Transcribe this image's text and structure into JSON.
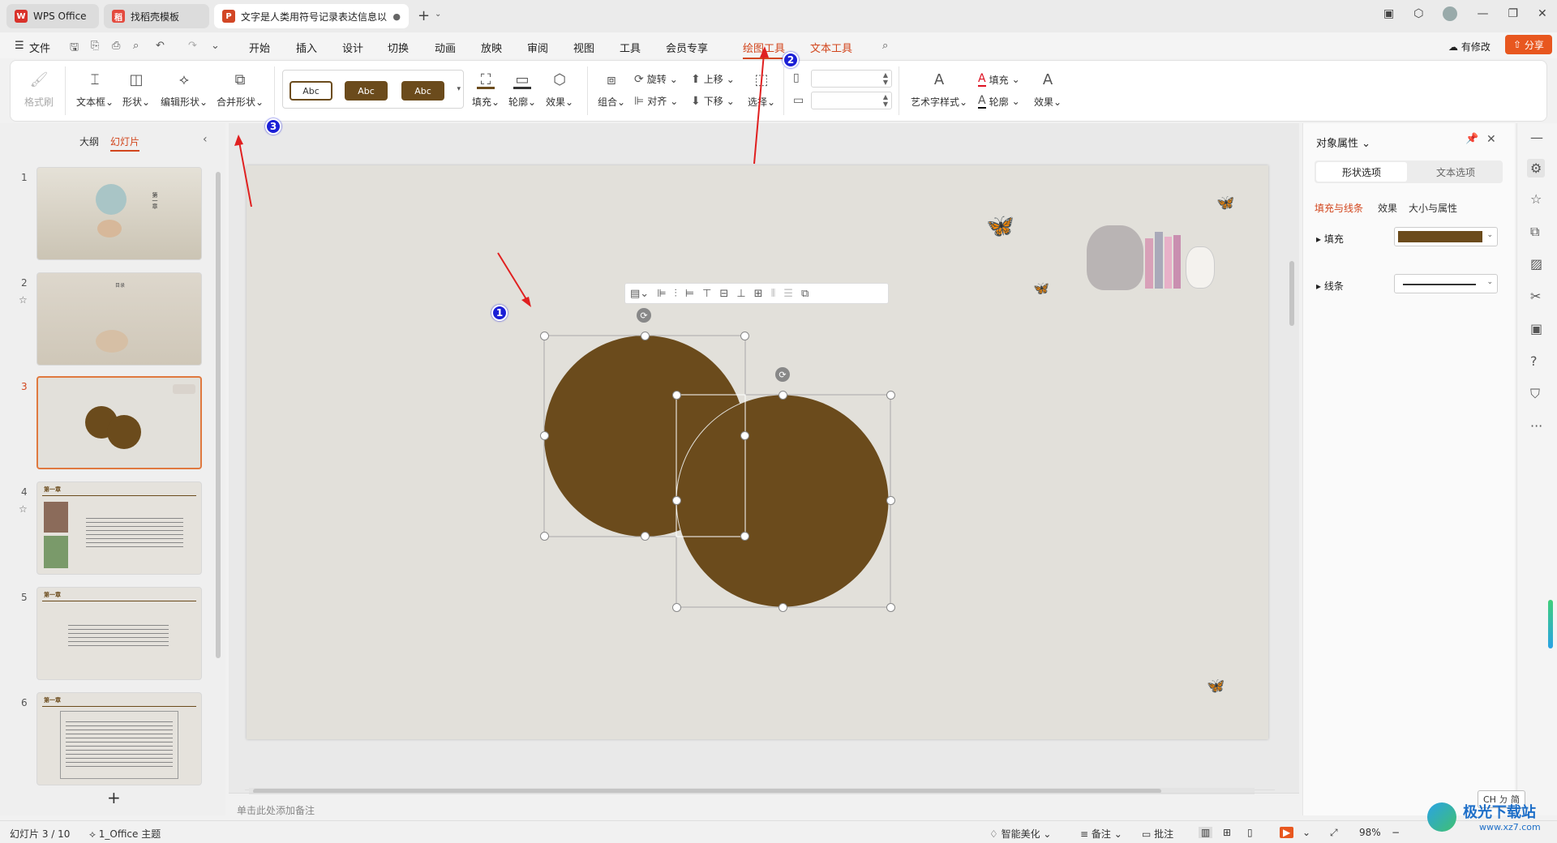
{
  "tabs": [
    {
      "label": "WPS Office",
      "logo": "W"
    },
    {
      "label": "找稻壳模板",
      "logo": "稻"
    },
    {
      "label": "文字是人类用符号记录表达信息以",
      "logo": "P"
    }
  ],
  "menu": {
    "file": "文件",
    "items": [
      "开始",
      "插入",
      "设计",
      "切换",
      "动画",
      "放映",
      "审阅",
      "视图",
      "工具",
      "会员专享"
    ],
    "drawing_tools": "绘图工具",
    "text_tools": "文本工具",
    "modify": "有修改",
    "share": "分享"
  },
  "ribbon": {
    "format_painter": "格式刷",
    "textbox": "文本框",
    "shape": "形状",
    "edit_shape": "编辑形状",
    "merge_shape": "合并形状",
    "style_samples": [
      "Abc",
      "Abc",
      "Abc"
    ],
    "fill": "填充",
    "outline": "轮廓",
    "effect": "效果",
    "rotate": "旋转",
    "align": "对齐",
    "bring_forward": "上移",
    "send_backward": "下移",
    "group": "组合",
    "select": "选择",
    "art_text": "艺术字样式",
    "text_fill": "填充",
    "text_outline": "轮廓",
    "text_effect": "效果"
  },
  "left_panel": {
    "tab_outline": "大纲",
    "tab_slides": "幻灯片",
    "slides": [
      {
        "num": "1",
        "title": "第一章"
      },
      {
        "num": "2",
        "title": "目录"
      },
      {
        "num": "3",
        "title": ""
      },
      {
        "num": "4",
        "title": "第一章"
      },
      {
        "num": "5",
        "title": "第一章"
      },
      {
        "num": "6",
        "title": "第一章"
      }
    ],
    "add_label": "+"
  },
  "notes_placeholder": "单击此处添加备注",
  "right_panel": {
    "title": "对象属性",
    "tab_shape": "形状选项",
    "tab_text": "文本选项",
    "subtabs": [
      "填充与线条",
      "效果",
      "大小与属性"
    ],
    "fill_label": "填充",
    "line_label": "线条",
    "fill_color": "#6b4b1c"
  },
  "status": {
    "slide_info": "幻灯片 3 / 10",
    "theme": "1_Office 主题",
    "beautify": "智能美化",
    "notes": "备注",
    "comments": "批注",
    "zoom": "98%"
  },
  "ime": "CH ㄉ 简",
  "watermark": {
    "name": "极光下载站",
    "url": "www.xz7.com"
  },
  "annotations": [
    "1",
    "2",
    "3"
  ],
  "colors": {
    "accent": "#d2461d",
    "shape": "#6b4b1c",
    "slide_bg": "#e2e0da"
  }
}
